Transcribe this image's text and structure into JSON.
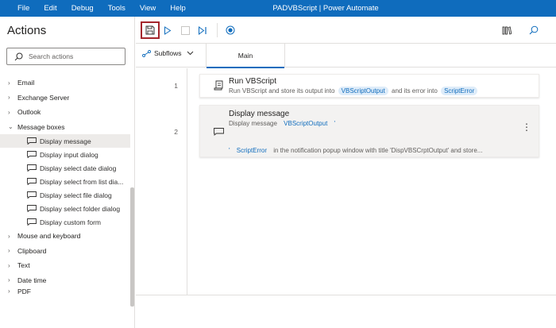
{
  "menu": {
    "items": [
      "File",
      "Edit",
      "Debug",
      "Tools",
      "View",
      "Help"
    ]
  },
  "app_title": "PADVBScript | Power Automate",
  "actions": {
    "title": "Actions",
    "search_placeholder": "Search actions",
    "groups_top": [
      {
        "label": "Email"
      },
      {
        "label": "Exchange Server"
      },
      {
        "label": "Outlook"
      },
      {
        "label": "Message boxes"
      }
    ],
    "message_boxes": [
      {
        "label": "Display message"
      },
      {
        "label": "Display input dialog"
      },
      {
        "label": "Display select date dialog"
      },
      {
        "label": "Display select from list dia..."
      },
      {
        "label": "Display select file dialog"
      },
      {
        "label": "Display select folder dialog"
      },
      {
        "label": "Display custom form"
      }
    ],
    "groups_bottom": [
      {
        "label": "Mouse and keyboard"
      },
      {
        "label": "Clipboard"
      },
      {
        "label": "Text"
      },
      {
        "label": "Date time"
      },
      {
        "label": "PDF"
      }
    ]
  },
  "toolbar": {
    "icons": [
      "save-icon",
      "run-icon",
      "stop-icon",
      "step-icon",
      "record-icon",
      "variables-icon",
      "search-icon"
    ]
  },
  "tabs": {
    "subflows_label": "Subflows",
    "main_label": "Main"
  },
  "steps": [
    {
      "line": "1",
      "title": "Run VBScript",
      "desc_prefix": "Run VBScript and store its output into",
      "var1": "VBScriptOutput",
      "desc_mid": "and its error into",
      "var2": "ScriptError"
    },
    {
      "line": "2",
      "title": "Display message",
      "desc_prefix": "Display message",
      "var1": "VBScriptOutput",
      "quote1": "'",
      "quote2": "'",
      "var2": "ScriptError",
      "desc_tail": "in the notification popup window with title 'DispVBSCrptOutput' and store...",
      "more": "⋮"
    }
  ],
  "colors": {
    "accent": "#0f6cbd",
    "highlight_border": "#a4262c"
  }
}
